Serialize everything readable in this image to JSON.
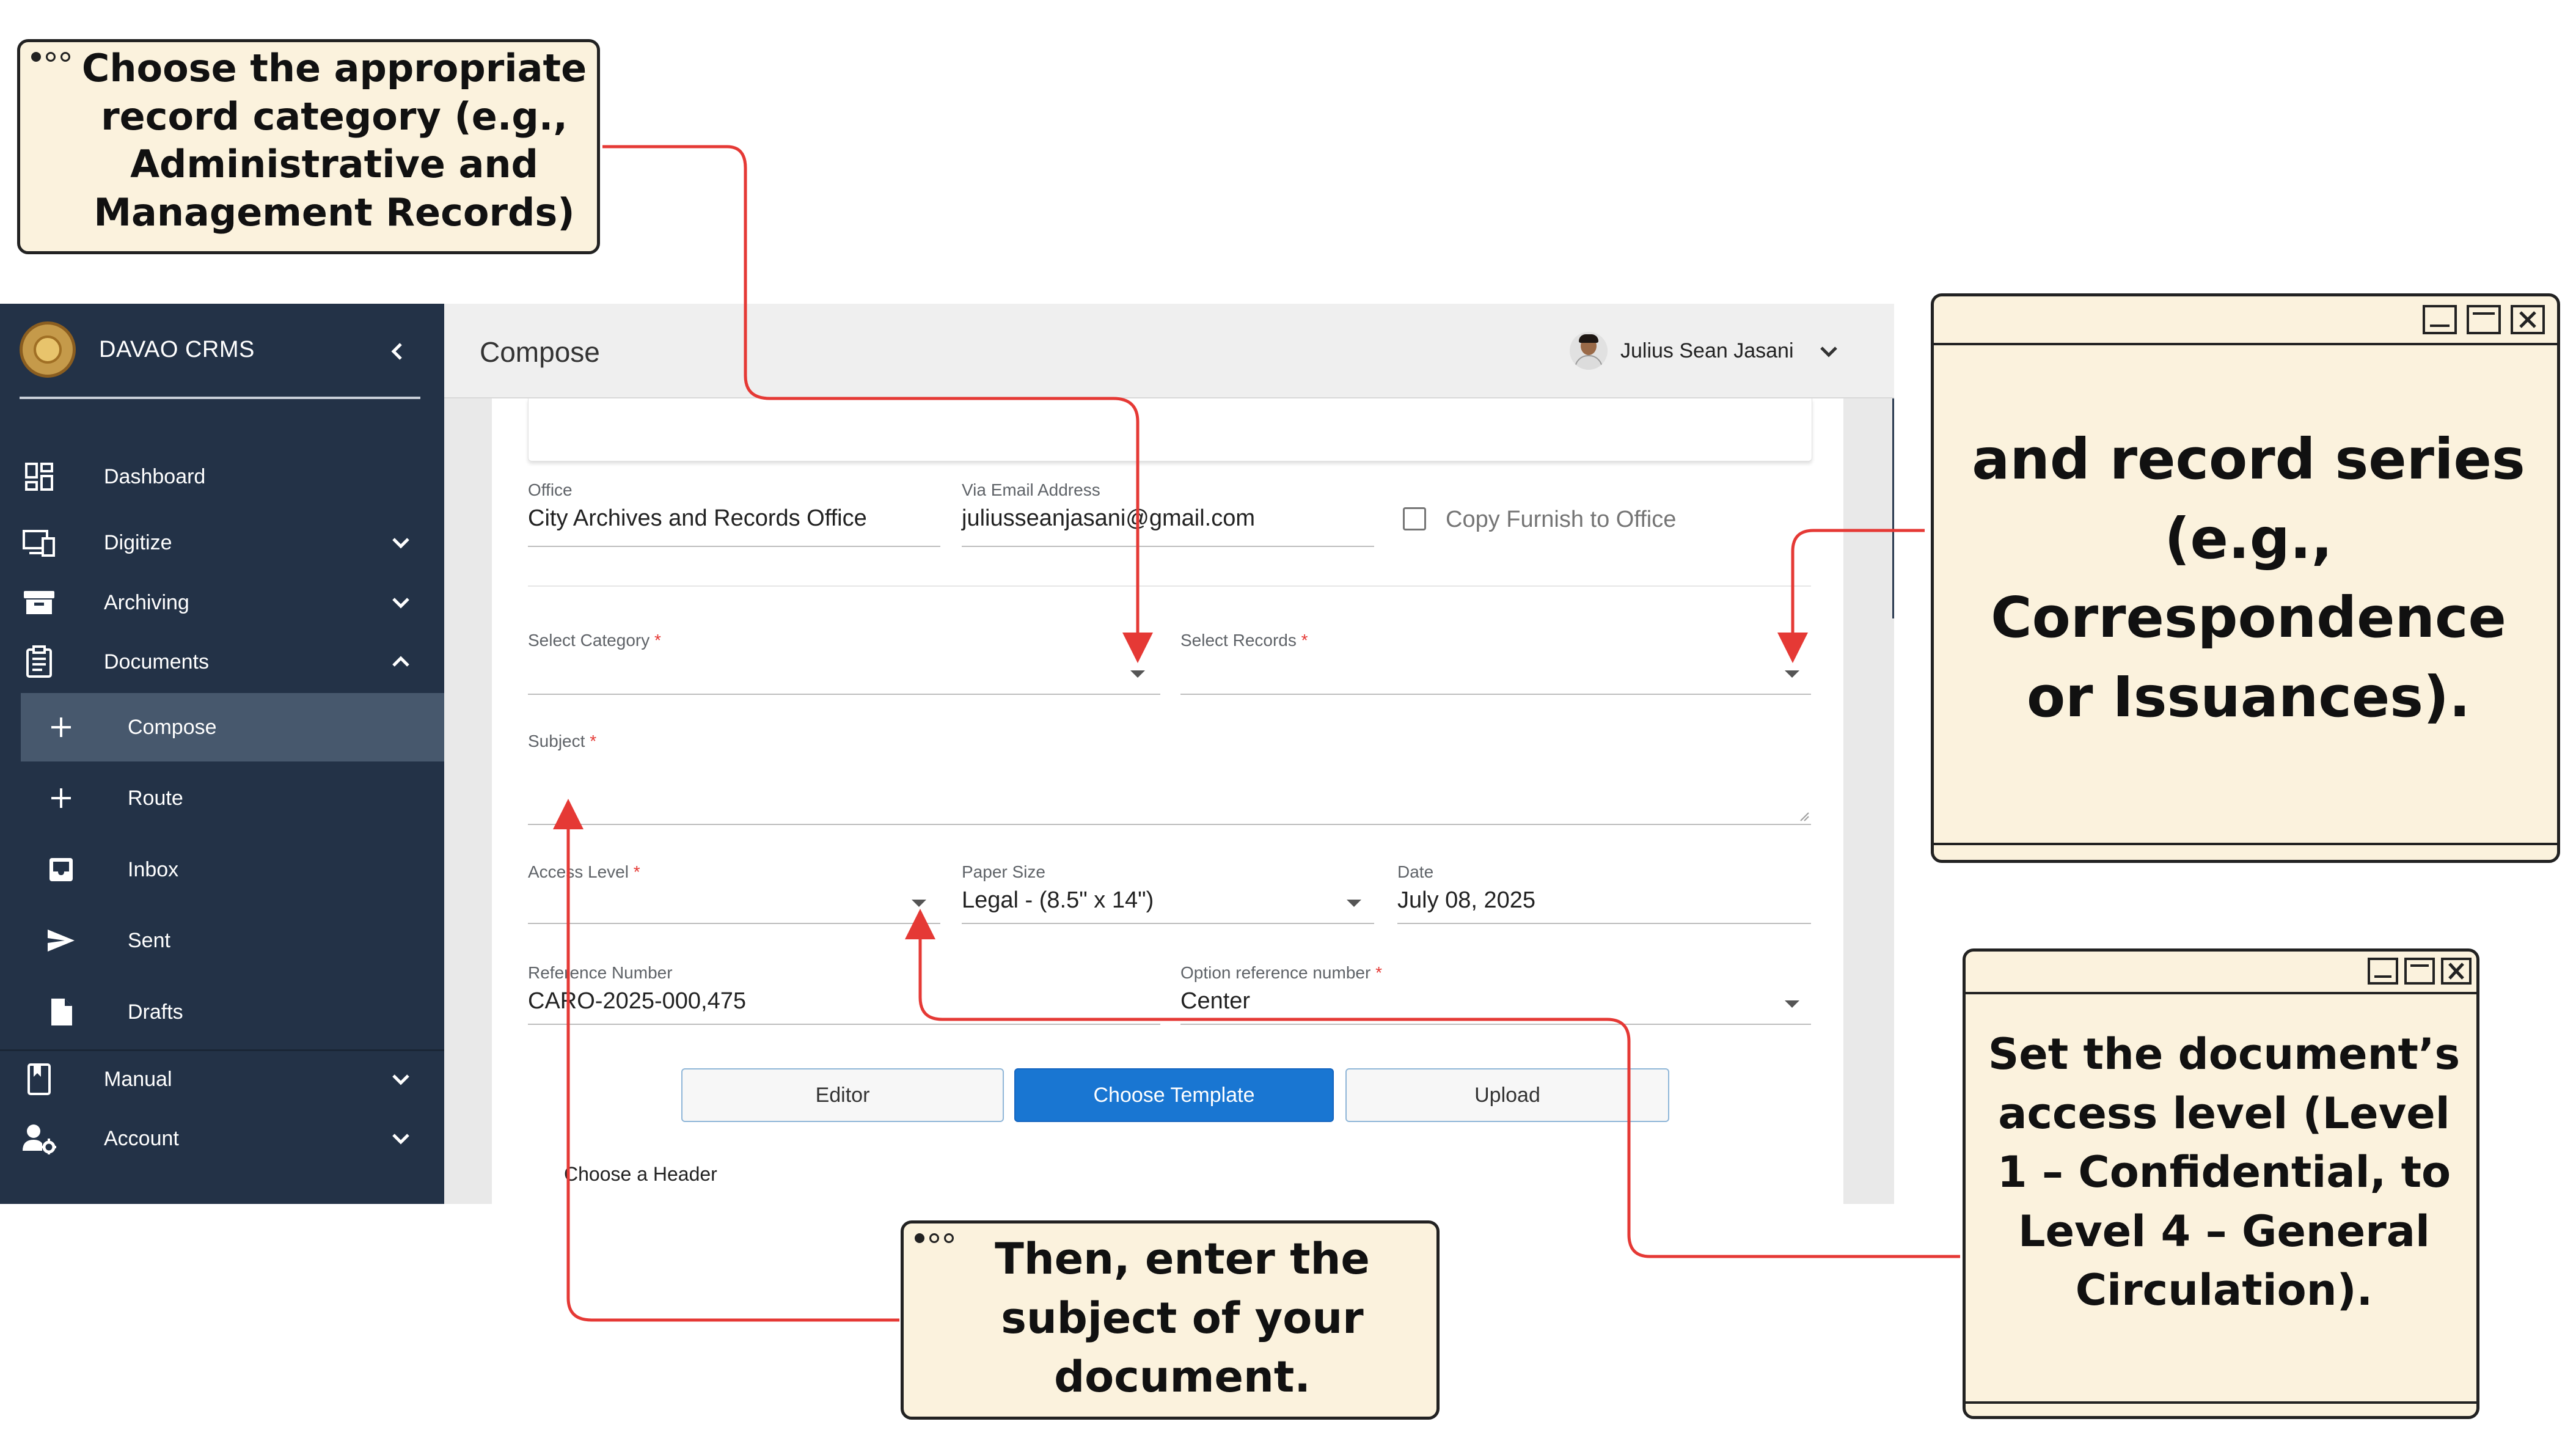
{
  "app": {
    "brand": "DAVAO CRMS",
    "page_title": "Compose",
    "user_name": "Julius Sean Jasani"
  },
  "sidebar": {
    "items": [
      {
        "label": "Dashboard",
        "icon": "dashboard-icon"
      },
      {
        "label": "Digitize",
        "icon": "devices-icon"
      },
      {
        "label": "Archiving",
        "icon": "archive-box-icon"
      },
      {
        "label": "Documents",
        "icon": "clipboard-icon"
      },
      {
        "label": "Manual",
        "icon": "book-icon"
      },
      {
        "label": "Account",
        "icon": "user-gear-icon"
      }
    ],
    "documents_sub": [
      {
        "label": "Compose",
        "icon": "plus-icon"
      },
      {
        "label": "Route",
        "icon": "plus-icon"
      },
      {
        "label": "Inbox",
        "icon": "inbox-icon"
      },
      {
        "label": "Sent",
        "icon": "send-icon"
      },
      {
        "label": "Drafts",
        "icon": "file-icon"
      }
    ]
  },
  "form": {
    "office": {
      "label": "Office",
      "value": "City Archives and Records Office"
    },
    "email": {
      "label": "Via Email Address",
      "value": "juliusseanjasani@gmail.com"
    },
    "copy_furnish": {
      "label": "Copy Furnish to Office",
      "checked": false
    },
    "category": {
      "label": "Select Category",
      "required": "*",
      "value": ""
    },
    "records": {
      "label": "Select Records",
      "required": "*",
      "value": ""
    },
    "subject": {
      "label": "Subject",
      "required": "*",
      "value": ""
    },
    "access_level": {
      "label": "Access Level",
      "required": "*",
      "value": ""
    },
    "paper_size": {
      "label": "Paper Size",
      "value": "Legal - (8.5\" x 14\")"
    },
    "date": {
      "label": "Date",
      "value": "July 08, 2025"
    },
    "reference_number": {
      "label": "Reference Number",
      "value": "CARO-2025-000,475"
    },
    "option_reference": {
      "label": "Option reference number",
      "required": "*",
      "value": "Center"
    },
    "buttons": {
      "editor": "Editor",
      "template": "Choose Template",
      "upload": "Upload"
    },
    "choose_header": "Choose a Header"
  },
  "callouts": {
    "category": "Choose the appropriate record category (e.g., Administrative and Management Records)",
    "series": "and record series (e.g., Correspondence or Issuances).",
    "access": "Set the document’s access level (Level 1 – Confidential, to Level 4 – General Circulation).",
    "subject": "Then, enter the subject of your document."
  },
  "colors": {
    "sidebar_bg": "#233247",
    "sidebar_active": "#47586d",
    "primary": "#1976d2",
    "callout_bg": "#fbf2dd",
    "arrow": "#e53935"
  }
}
